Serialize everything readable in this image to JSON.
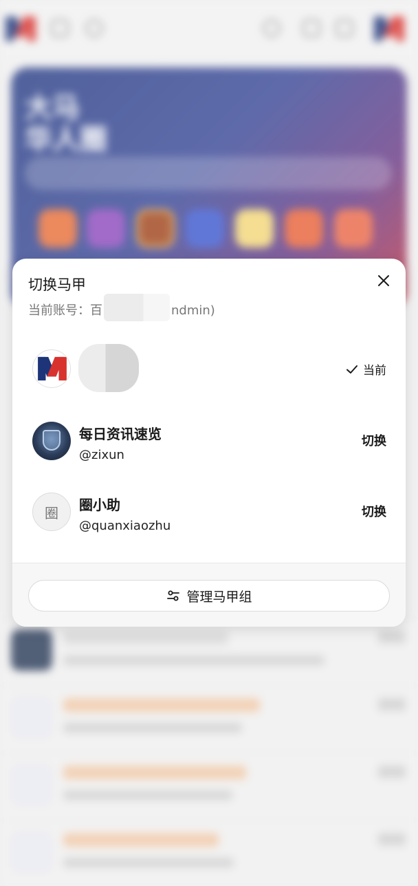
{
  "background": {
    "hero_title_line1": "大马",
    "hero_title_line2": "华人圈"
  },
  "sheet": {
    "title": "切换马甲",
    "current_account_label": "当前账号：",
    "current_account_prefix": "百",
    "current_account_suffix": "ndmin)",
    "accounts": [
      {
        "name": "",
        "handle": "",
        "status": "当前",
        "avatar": "logo-m"
      },
      {
        "name": "每日资讯速览",
        "handle": "@zixun",
        "action": "切换",
        "avatar": "news-badge"
      },
      {
        "name": "圈小助",
        "handle": "@quanxiaozhu",
        "action": "切换",
        "avatar_text": "圈"
      }
    ],
    "manage_label": "管理马甲组"
  },
  "colors": {
    "brand_blue": "#1d3478",
    "brand_red": "#d8322e"
  }
}
